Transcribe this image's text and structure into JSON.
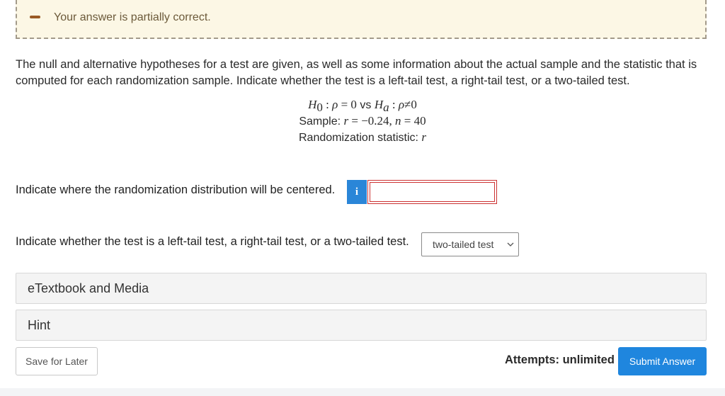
{
  "feedback": {
    "message": "Your answer is partially correct."
  },
  "question": {
    "intro": "The null and alternative hypotheses for a test are given, as well as some information about the actual sample and the statistic that is computed for each randomization sample. Indicate whether the test is a left-tail test, a right-tail test, or a two-tailed test.",
    "hypotheses": {
      "h0_var": "H",
      "h0_sub": "0",
      "h0_rel": " : ",
      "h0_param": "ρ",
      "h0_eq": " = 0",
      "vs": " vs ",
      "ha_var": "H",
      "ha_sub": "a",
      "ha_rel": " : ",
      "ha_param": "ρ",
      "ha_neq": "≠0"
    },
    "sample": {
      "label": "Sample: ",
      "r_var": "r",
      "r_val": " = −0.24, ",
      "n_var": "n",
      "n_val": " = 40"
    },
    "randomization": {
      "label": "Randomization statistic: ",
      "stat_var": "r"
    },
    "part1": {
      "prompt": "Indicate where the randomization distribution will be centered.",
      "info_icon_label": "i",
      "answer_value": ""
    },
    "part2": {
      "prompt": "Indicate whether the test is a left-tail test, a right-tail test, or a two-tailed test.",
      "selected": "two-tailed test"
    }
  },
  "panels": {
    "etextbook": "eTextbook and Media",
    "hint": "Hint"
  },
  "footer": {
    "save_label": "Save for Later",
    "attempts_label": "Attempts: unlimited",
    "submit_label": "Submit Answer"
  },
  "colors": {
    "accent": "#1f86de",
    "error": "#cc3333",
    "feedback_bg": "#fcf7e5",
    "feedback_icon": "#9a5a25"
  }
}
